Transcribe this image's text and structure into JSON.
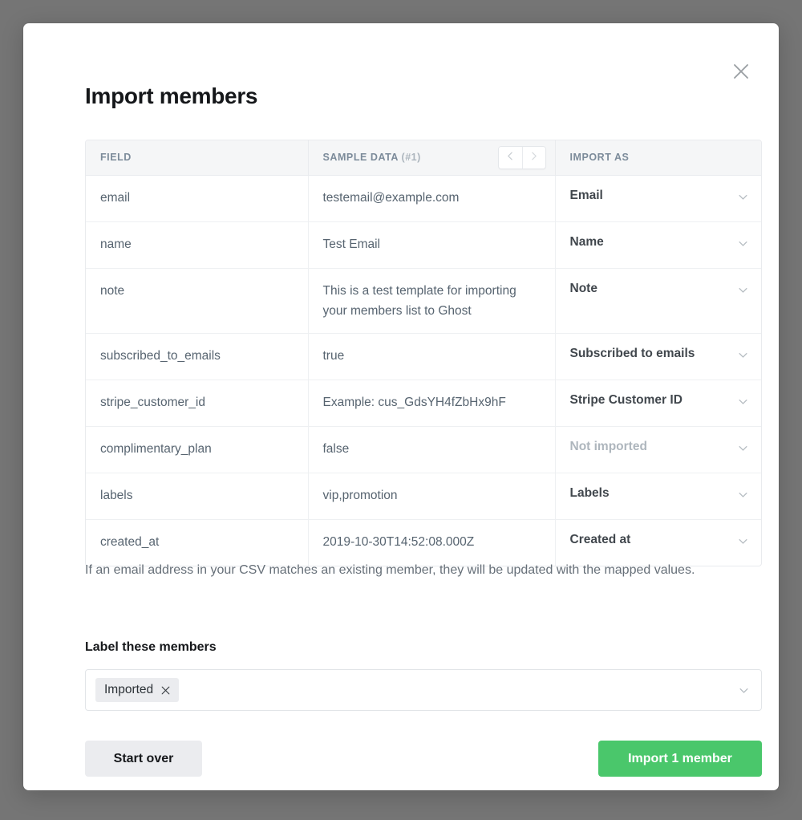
{
  "modal": {
    "title": "Import members",
    "close_icon": "close-icon"
  },
  "table": {
    "headers": {
      "field": "FIELD",
      "sample_data": "SAMPLE DATA",
      "sample_index": "(#1)",
      "import_as": "IMPORT AS"
    },
    "pager": {
      "prev_icon": "chevron-left-icon",
      "next_icon": "chevron-right-icon"
    },
    "rows": [
      {
        "field": "email",
        "sample": "testemail@example.com",
        "import_as": "Email",
        "not_imported": false
      },
      {
        "field": "name",
        "sample": "Test Email",
        "import_as": "Name",
        "not_imported": false
      },
      {
        "field": "note",
        "sample": "This is a test template for importing your members list to Ghost",
        "import_as": "Note",
        "not_imported": false
      },
      {
        "field": "subscribed_to_emails",
        "sample": "true",
        "import_as": "Subscribed to emails",
        "not_imported": false
      },
      {
        "field": "stripe_customer_id",
        "sample": "Example: cus_GdsYH4fZbHx9hF",
        "import_as": "Stripe Customer ID",
        "not_imported": false
      },
      {
        "field": "complimentary_plan",
        "sample": "false",
        "import_as": "Not imported",
        "not_imported": true
      },
      {
        "field": "labels",
        "sample": "vip,promotion",
        "import_as": "Labels",
        "not_imported": false
      },
      {
        "field": "created_at",
        "sample": "2019-10-30T14:52:08.000Z",
        "import_as": "Created at",
        "not_imported": false
      }
    ]
  },
  "helper_text": "If an email address in your CSV matches an existing member, they will be updated with the mapped values.",
  "label_section": {
    "heading": "Label these members",
    "tokens": [
      "Imported"
    ],
    "remove_icon": "close-icon",
    "caret_icon": "chevron-down-icon"
  },
  "footer": {
    "start_over_label": "Start over",
    "import_label": "Import 1 member"
  },
  "colors": {
    "backdrop": "#757575",
    "primary_green": "#4ac76b",
    "secondary_grey": "#ebecef",
    "header_grey": "#f5f6f7",
    "text_dark": "#15171a",
    "text_body": "#576470",
    "text_muted": "#aeb6bd"
  }
}
